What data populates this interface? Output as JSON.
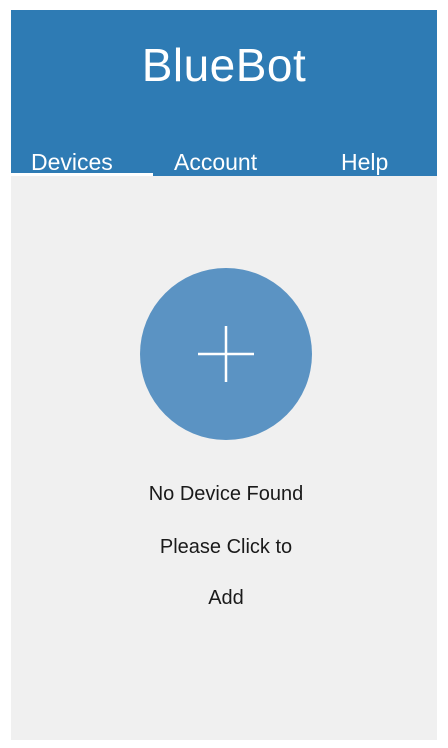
{
  "app": {
    "title": "BlueBot"
  },
  "tabs": [
    {
      "label": "Devices",
      "active": true
    },
    {
      "label": "Account",
      "active": false
    },
    {
      "label": "Help",
      "active": false
    }
  ],
  "empty_state": {
    "icon": "plus-icon",
    "line1": "No Device Found",
    "line2": "Please Click to",
    "line3": "Add"
  },
  "colors": {
    "header_background": "#2e7bb4",
    "add_button": "#5b93c3",
    "content_background": "#f0f0f0"
  }
}
